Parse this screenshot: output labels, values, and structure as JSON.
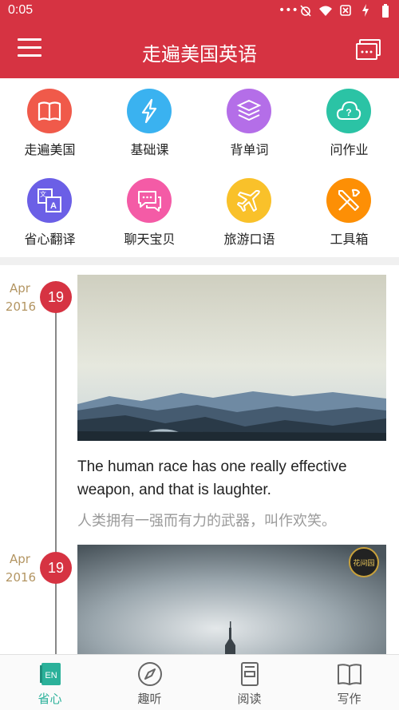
{
  "status_bar": {
    "time": "0:05"
  },
  "header": {
    "title": "走遍美国英语"
  },
  "grid": [
    {
      "label": "走遍美国",
      "icon": "book-icon",
      "color": "#f05a4a"
    },
    {
      "label": "基础课",
      "icon": "lightning-icon",
      "color": "#3ab2f0"
    },
    {
      "label": "背单词",
      "icon": "word-stack-icon",
      "color": "#b46ee8"
    },
    {
      "label": "问作业",
      "icon": "cloud-question-icon",
      "color": "#2bc3a5"
    },
    {
      "label": "省心翻译",
      "icon": "translate-icon",
      "color": "#6b5fe6"
    },
    {
      "label": "聊天宝贝",
      "icon": "chat-bubbles-icon",
      "color": "#f45ba6"
    },
    {
      "label": "旅游口语",
      "icon": "airplane-icon",
      "color": "#f9c12a"
    },
    {
      "label": "工具箱",
      "icon": "tools-icon",
      "color": "#fd8f05"
    }
  ],
  "timeline": [
    {
      "month": "Apr",
      "year": "2016",
      "day": "19",
      "en": "The human race has one really effective weapon, and that is laughter.",
      "zh": "人类拥有一强而有力的武器，叫作欢笑。"
    },
    {
      "month": "Apr",
      "year": "2016",
      "day": "19",
      "badge": "花间园"
    }
  ],
  "bottom_nav": [
    {
      "label": "省心",
      "icon": "en-book-icon",
      "badge_text": "EN",
      "active": true
    },
    {
      "label": "趣听",
      "icon": "compass-icon"
    },
    {
      "label": "阅读",
      "icon": "reading-icon"
    },
    {
      "label": "写作",
      "icon": "open-book-icon"
    }
  ],
  "colors": {
    "brand": "#d63342",
    "accent": "#2bb19a",
    "date_gold": "#b39562"
  }
}
